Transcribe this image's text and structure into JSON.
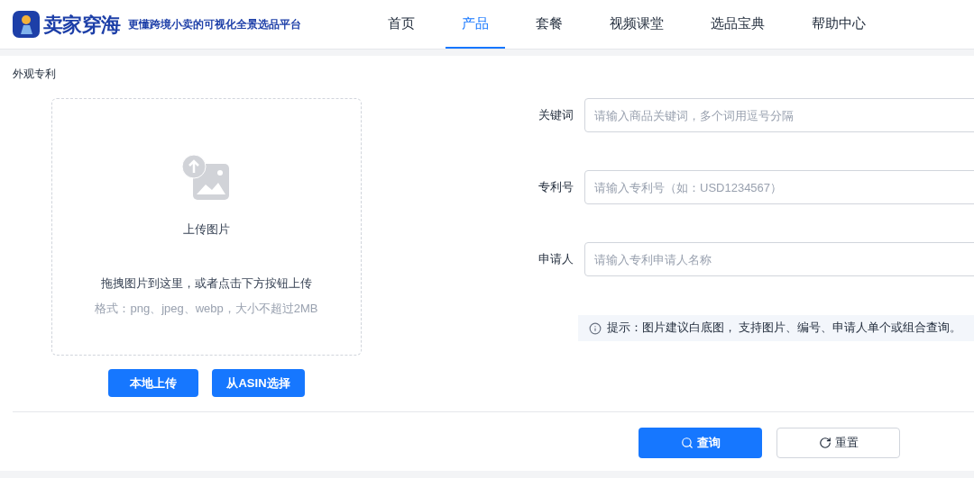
{
  "brand": {
    "name": "卖家穿海",
    "slogan": "更懂跨境小卖的可视化全景选品平台"
  },
  "nav": [
    {
      "label": "首页",
      "selected": false
    },
    {
      "label": "产品",
      "selected": true
    },
    {
      "label": "套餐",
      "selected": false
    },
    {
      "label": "视频课堂",
      "selected": false
    },
    {
      "label": "选品宝典",
      "selected": false
    },
    {
      "label": "帮助中心",
      "selected": false
    }
  ],
  "section_title": "外观专利",
  "upload": {
    "title": "上传图片",
    "instruction": "拖拽图片到这里，或者点击下方按钮上传",
    "format": "格式：png、jpeg、webp，大小不超过2MB",
    "buttons": [
      "本地上传",
      "从ASIN选择"
    ]
  },
  "fields": [
    {
      "label": "关键词",
      "placeholder": "请输入商品关键词，多个词用逗号分隔"
    },
    {
      "label": "专利号",
      "placeholder": "请输入专利号（如：USD1234567）"
    },
    {
      "label": "申请人",
      "placeholder": "请输入专利申请人名称"
    }
  ],
  "hint": "提示：图片建议白底图， 支持图片、编号、申请人单个或组合查询。",
  "actions": [
    {
      "kind": "primary",
      "label": "查询"
    },
    {
      "kind": "secondary",
      "label": "重置"
    }
  ]
}
